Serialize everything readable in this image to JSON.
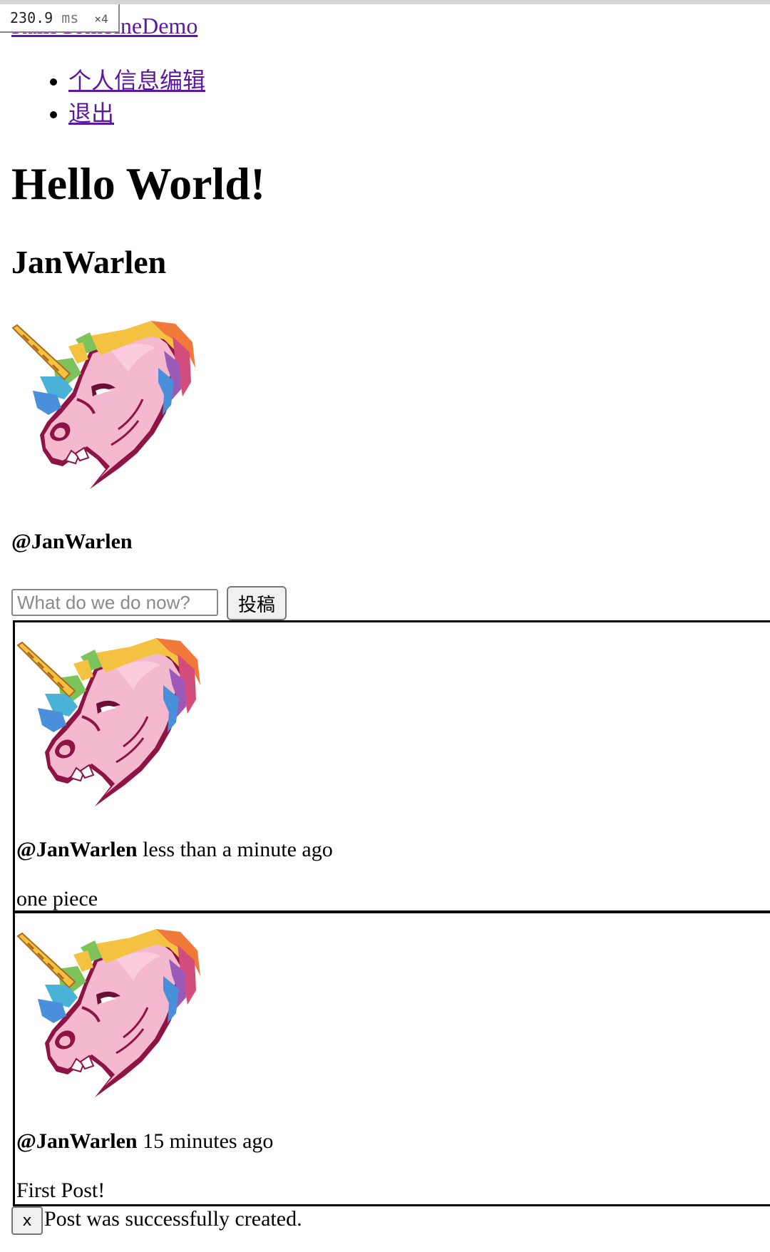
{
  "devtools": {
    "timing_value": "230.9",
    "timing_unit": "ms",
    "timing_multiplier": "×4"
  },
  "site": {
    "title": "RailsCombineDemo"
  },
  "nav": {
    "items": [
      {
        "label": "个人信息编辑"
      },
      {
        "label": "退出"
      }
    ]
  },
  "page": {
    "heading": "Hello World!",
    "username": "JanWarlen",
    "handle": "@JanWarlen"
  },
  "avatar": {
    "icon": "pink-unicorn-avatar"
  },
  "composer": {
    "placeholder": "What do we do now?",
    "submit_label": "投稿"
  },
  "posts": [
    {
      "author": "@JanWarlen",
      "time": "less than a minute ago",
      "content": "one piece"
    },
    {
      "author": "@JanWarlen",
      "time": "15 minutes ago",
      "content": "First Post!"
    }
  ],
  "flash": {
    "close_label": "x",
    "message": "Post was successfully created."
  },
  "colors": {
    "link": "#5a19a0",
    "unicorn_pink": "#f4b8cf",
    "unicorn_outline": "#b01c50"
  }
}
